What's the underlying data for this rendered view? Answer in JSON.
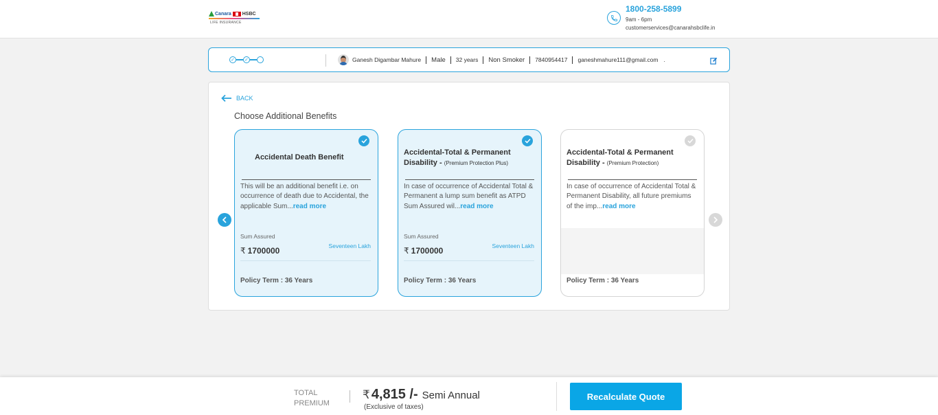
{
  "header": {
    "logo": {
      "canara": "Canara",
      "hsbc": "HSBC",
      "sub": "LIFE INSURANCE"
    },
    "phone": "1800-258-5899",
    "hours": "9am - 6pm",
    "email": "customerservices@canarahsbclife.in"
  },
  "infobar": {
    "name": "Ganesh Digambar Mahure",
    "gender": "Male",
    "age": "32 years",
    "smoker": "Non Smoker",
    "mobile": "7840954417",
    "email": "ganeshmahure111@gmail.com",
    "dot": ".",
    "steps": [
      "completed",
      "completed",
      "current"
    ]
  },
  "benefits": {
    "back_label": "BACK",
    "title": "Choose Additional Benefits",
    "cards": [
      {
        "title": "Accidental Death Benefit",
        "tag": "",
        "description": "This will be an additional benefit i.e. on occurrence of death due to Accidental, the applicable Sum...",
        "read_more": "read more",
        "sum_assured_label": "Sum Assured",
        "currency": "₹",
        "sum_assured": "1700000",
        "sum_assured_words": "Seventeen Lakh",
        "policy_term": "Policy Term : 36 Years",
        "selected": true
      },
      {
        "title": "Accidental-Total & Permanent Disability - ",
        "tag": "(Premium Protection Plus)",
        "description": "In case of occurrence of Accidental Total & Permanent a lump sum benefit as ATPD Sum Assured wil...",
        "read_more": "read more",
        "sum_assured_label": "Sum Assured",
        "currency": "₹",
        "sum_assured": "1700000",
        "sum_assured_words": "Seventeen Lakh",
        "policy_term": "Policy Term : 36 Years",
        "selected": true
      },
      {
        "title": "Accidental-Total & Permanent Disability - ",
        "tag": "(Premium Protection)",
        "description": "In case of occurrence of Accidental Total & Permanent Disability, all future premiums of the imp...",
        "read_more": "read more",
        "policy_term": "Policy Term : 36 Years",
        "selected": false
      }
    ]
  },
  "footer": {
    "label_line1": "TOTAL",
    "label_line2": "PREMIUM",
    "currency": "₹",
    "amount": "4,815 /-",
    "frequency": "Semi Annual",
    "note": "(Exclusive of taxes)",
    "button": "Recalculate Quote"
  },
  "colors": {
    "accent": "#29a3dc",
    "button": "#0aa6e6",
    "selected_card_bg": "#e6f4fb"
  }
}
